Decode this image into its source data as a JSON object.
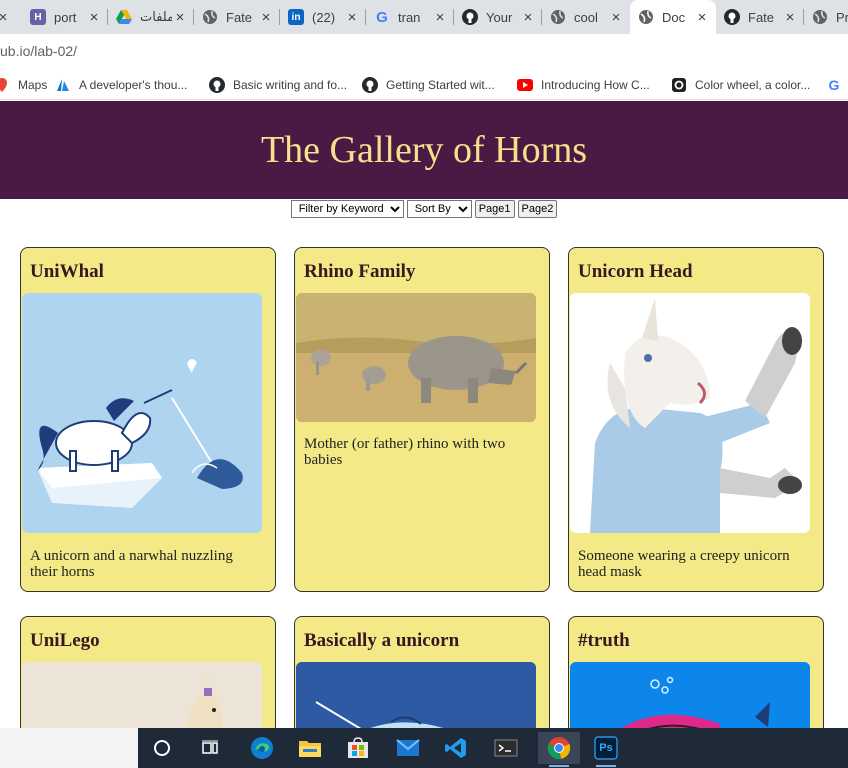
{
  "browser": {
    "tabs": [
      {
        "title": "port",
        "icon": "heroku-icon",
        "color": "#6762a6"
      },
      {
        "title": "ملفات",
        "icon": "google-drive-icon",
        "color": "#f4b400"
      },
      {
        "title": "Fate",
        "icon": "globe-icon",
        "color": "#5f6368"
      },
      {
        "title": "(22)",
        "icon": "linkedin-icon",
        "color": "#0a66c2"
      },
      {
        "title": "tran",
        "icon": "google-icon",
        "color": "#4285f4"
      },
      {
        "title": "Your",
        "icon": "github-icon",
        "color": "#24292f"
      },
      {
        "title": "cool",
        "icon": "globe-icon",
        "color": "#5f6368"
      },
      {
        "title": "Doc",
        "icon": "globe-icon",
        "color": "#5f6368"
      },
      {
        "title": "Fate",
        "icon": "github-icon",
        "color": "#24292f"
      },
      {
        "title": "Pr",
        "icon": "globe-icon",
        "color": "#5f6368"
      }
    ],
    "active_tab": 7,
    "close_glyph": "×",
    "url": "ub.io/lab-02/",
    "bookmarks": [
      {
        "label": "Maps",
        "icon": "maps-icon"
      },
      {
        "label": "A developer's thou...",
        "icon": "azure-icon"
      },
      {
        "label": "Basic writing and fo...",
        "icon": "github-icon"
      },
      {
        "label": "Getting Started wit...",
        "icon": "github-icon"
      },
      {
        "label": "Introducing How C...",
        "icon": "youtube-icon"
      },
      {
        "label": "Color wheel, a color...",
        "icon": "canva-icon"
      },
      {
        "label": "",
        "icon": "google-icon"
      }
    ]
  },
  "page": {
    "title": "The Gallery of Horns",
    "controls": {
      "filter_label": "Filter by Keyword",
      "sort_label": "Sort By",
      "page1_label": "Page1",
      "page2_label": "Page2"
    },
    "cards": [
      {
        "title": "UniWhal",
        "description": "A unicorn and a narwhal nuzzling their horns"
      },
      {
        "title": "Rhino Family",
        "description": "Mother (or father) rhino with two babies"
      },
      {
        "title": "Unicorn Head",
        "description": "Someone wearing a creepy unicorn head mask"
      },
      {
        "title": "UniLego",
        "description": ""
      },
      {
        "title": "Basically a unicorn",
        "description": ""
      },
      {
        "title": "#truth",
        "description": ""
      }
    ]
  },
  "taskbar": {
    "items": [
      "search-icon",
      "task-view-icon",
      "edge-icon",
      "file-explorer-icon",
      "store-icon",
      "mail-icon",
      "vscode-icon",
      "terminal-icon",
      "chrome-icon",
      "photoshop-icon"
    ],
    "photoshop_label": "Ps"
  },
  "colors": {
    "header_bg": "#4a1a45",
    "header_text": "#f7e08c",
    "card_bg": "#f3ea87",
    "card_title": "#3b1620"
  }
}
